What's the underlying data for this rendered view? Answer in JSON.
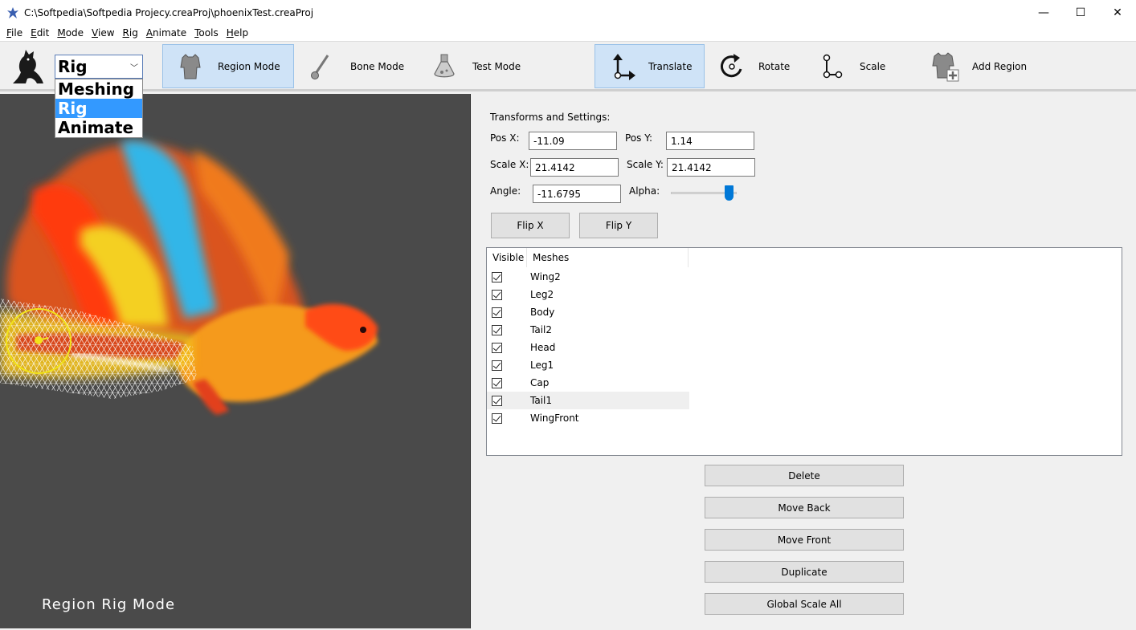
{
  "window": {
    "title": "C:\\Softpedia\\Softpedia Projecy.creaProj\\phoenixTest.creaProj",
    "minimize": "—",
    "maximize": "☐",
    "close": "✕"
  },
  "menu": {
    "file": {
      "u": "F",
      "rest": "ile"
    },
    "edit": {
      "u": "E",
      "rest": "dit"
    },
    "mode": {
      "u": "M",
      "rest": "ode"
    },
    "view": {
      "u": "V",
      "rest": "iew"
    },
    "rig": {
      "u": "R",
      "rest": "ig"
    },
    "animate": {
      "u": "A",
      "rest": "nimate"
    },
    "tools": {
      "u": "T",
      "rest": "ools"
    },
    "help": {
      "u": "H",
      "rest": "elp"
    }
  },
  "toolbar": {
    "mode_value": "Rig",
    "mode_options": [
      "Meshing",
      "Rig",
      "Animate"
    ],
    "region_mode": "Region Mode",
    "bone_mode": "Bone Mode",
    "test_mode": "Test Mode",
    "translate": "Translate",
    "rotate": "Rotate",
    "scale": "Scale",
    "add_region": "Add Region"
  },
  "canvas": {
    "mode_label": "Region Rig Mode"
  },
  "transforms": {
    "heading": "Transforms and Settings:",
    "pos_x_label": "Pos X:",
    "pos_x": "-11.09",
    "pos_y_label": "Pos Y:",
    "pos_y": "1.14",
    "scale_x_label": "Scale X:",
    "scale_x": "21.4142",
    "scale_y_label": "Scale Y:",
    "scale_y": "21.4142",
    "angle_label": "Angle:",
    "angle": "-11.6795",
    "alpha_label": "Alpha:",
    "alpha_level": 0.95,
    "flip_x": "Flip X",
    "flip_y": "Flip Y"
  },
  "meshes": {
    "col_visible": "Visible",
    "col_meshes": "Meshes",
    "rows": [
      {
        "name": "Wing2",
        "visible": true
      },
      {
        "name": "Leg2",
        "visible": true
      },
      {
        "name": "Body",
        "visible": true
      },
      {
        "name": "Tail2",
        "visible": true
      },
      {
        "name": "Head",
        "visible": true
      },
      {
        "name": "Leg1",
        "visible": true
      },
      {
        "name": "Cap",
        "visible": true
      },
      {
        "name": "Tail1",
        "visible": true
      },
      {
        "name": "WingFront",
        "visible": true
      }
    ]
  },
  "actions": {
    "delete": "Delete",
    "move_back": "Move Back",
    "move_front": "Move Front",
    "duplicate": "Duplicate",
    "global_scale": "Global Scale All"
  },
  "colors": {
    "accent": "#0078d7",
    "active_tool": "#cfe3f7",
    "canvas_bg": "#4a4a4a"
  }
}
